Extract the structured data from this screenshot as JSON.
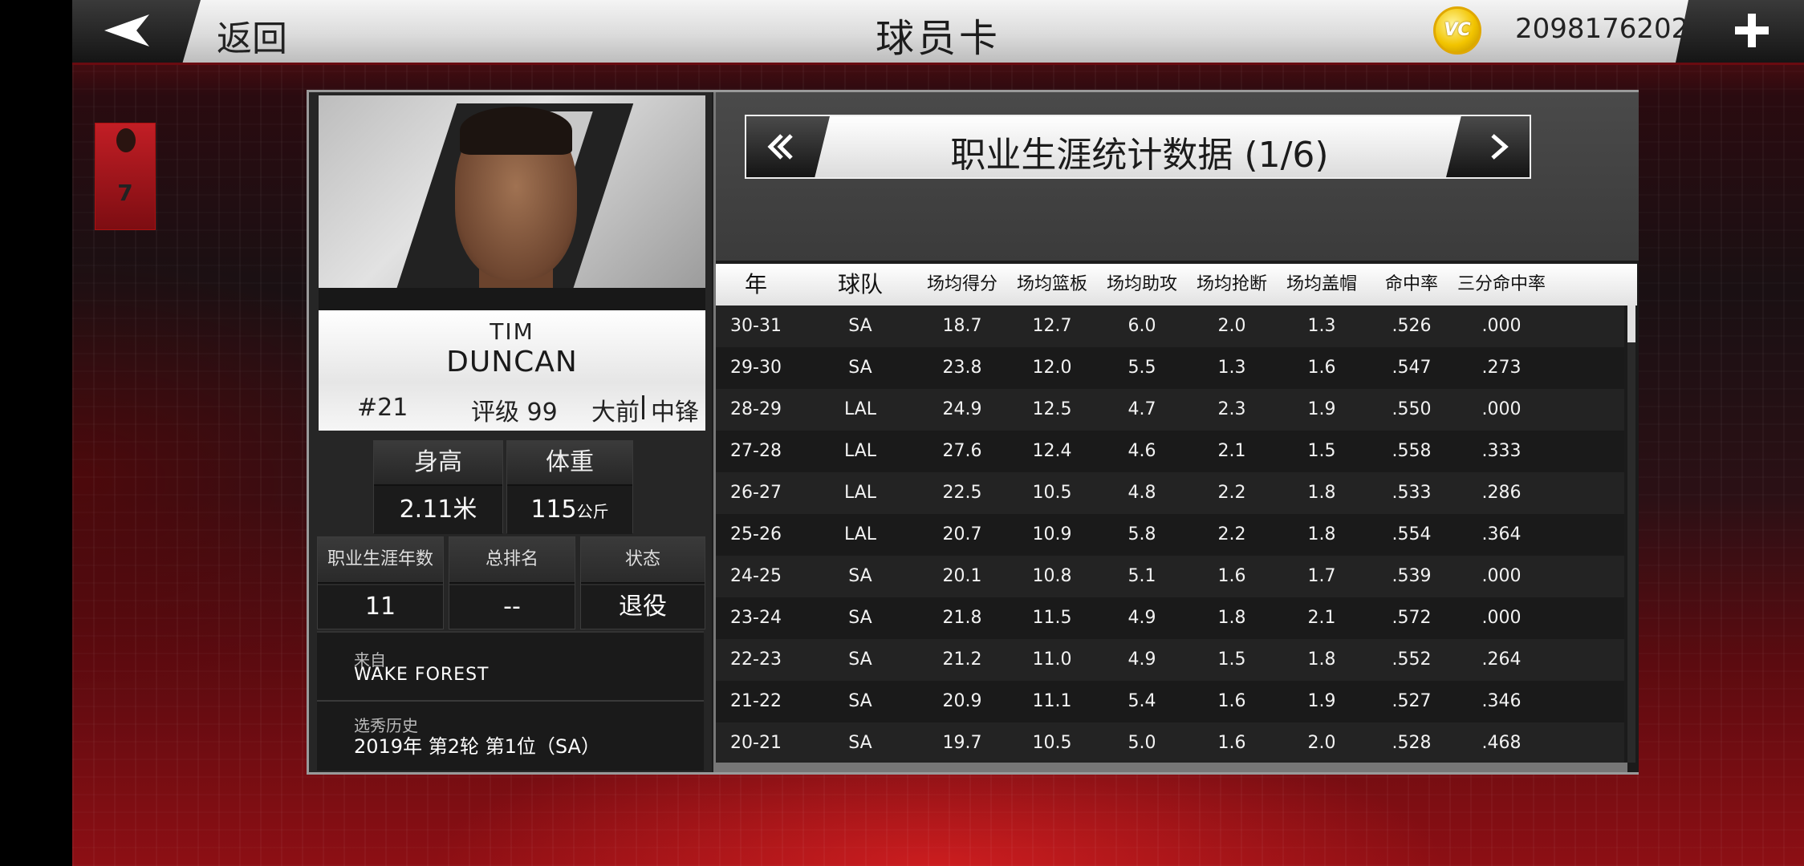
{
  "topbar": {
    "back_label": "返回",
    "title": "球员卡",
    "currency_icon_text": "VC",
    "currency_amount": "2098176202"
  },
  "player": {
    "first_name": "TIM",
    "last_name": "DUNCAN",
    "number": "#21",
    "rating": "评级 99",
    "position_primary": "大前",
    "position_secondary": "中锋",
    "height_label": "身高",
    "height_value": "2.11米",
    "weight_label": "体重",
    "weight_value": "115",
    "weight_unit": "公斤",
    "career_years_label": "职业生涯年数",
    "career_years_value": "11",
    "rank_label": "总排名",
    "rank_value": "--",
    "status_label": "状态",
    "status_value": "退役",
    "from_label": "来自",
    "from_value": "WAKE FOREST",
    "draft_label": "选秀历史",
    "draft_value": "2019年 第2轮 第1位（SA）"
  },
  "stats": {
    "title": "职业生涯统计数据 (1/6)",
    "columns": [
      "年",
      "球队",
      "场均得分",
      "场均篮板",
      "场均助攻",
      "场均抢断",
      "场均盖帽",
      "命中率",
      "三分命中率"
    ],
    "rows": [
      [
        "30-31",
        "SA",
        "18.7",
        "12.7",
        "6.0",
        "2.0",
        "1.3",
        ".526",
        ".000"
      ],
      [
        "29-30",
        "SA",
        "23.8",
        "12.0",
        "5.5",
        "1.3",
        "1.6",
        ".547",
        ".273"
      ],
      [
        "28-29",
        "LAL",
        "24.9",
        "12.5",
        "4.7",
        "2.3",
        "1.9",
        ".550",
        ".000"
      ],
      [
        "27-28",
        "LAL",
        "27.6",
        "12.4",
        "4.6",
        "2.1",
        "1.5",
        ".558",
        ".333"
      ],
      [
        "26-27",
        "LAL",
        "22.5",
        "10.5",
        "4.8",
        "2.2",
        "1.8",
        ".533",
        ".286"
      ],
      [
        "25-26",
        "LAL",
        "20.7",
        "10.9",
        "5.8",
        "2.2",
        "1.8",
        ".554",
        ".364"
      ],
      [
        "24-25",
        "SA",
        "20.1",
        "10.8",
        "5.1",
        "1.6",
        "1.7",
        ".539",
        ".000"
      ],
      [
        "23-24",
        "SA",
        "21.8",
        "11.5",
        "4.9",
        "1.8",
        "2.1",
        ".572",
        ".000"
      ],
      [
        "22-23",
        "SA",
        "21.2",
        "11.0",
        "4.9",
        "1.5",
        "1.8",
        ".552",
        ".264"
      ],
      [
        "21-22",
        "SA",
        "20.9",
        "11.1",
        "5.4",
        "1.6",
        "1.9",
        ".527",
        ".346"
      ],
      [
        "20-21",
        "SA",
        "19.7",
        "10.5",
        "5.0",
        "1.6",
        "2.0",
        ".528",
        ".468"
      ]
    ]
  },
  "side_thumb": {
    "jersey_number": "7"
  },
  "colors": {
    "accent_red": "#8d0f14",
    "coin_gold": "#f2c400"
  },
  "icons": [
    "back-arrow-icon",
    "vc-coin-icon",
    "plus-icon",
    "chevron-left-icon",
    "chevron-right-icon"
  ]
}
